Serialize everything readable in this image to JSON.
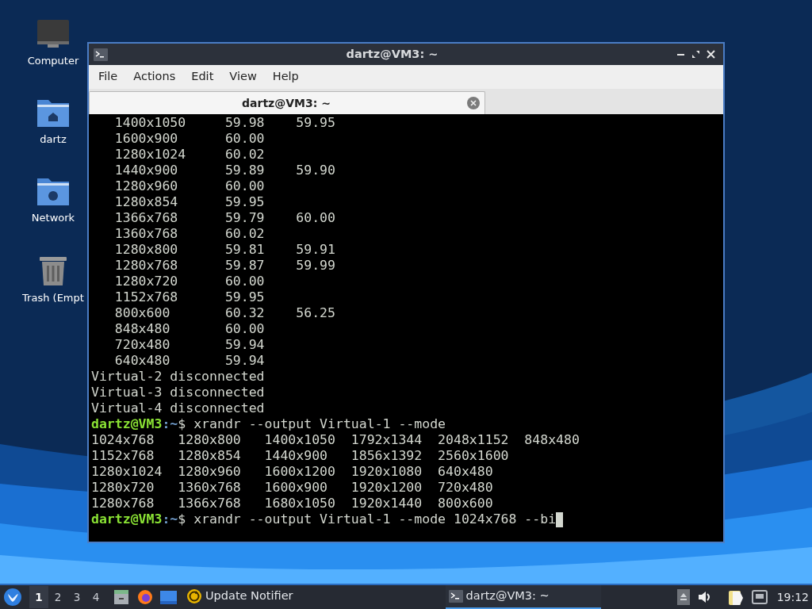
{
  "desktop_icons": [
    {
      "label": "Computer",
      "kind": "computer"
    },
    {
      "label": "dartz",
      "kind": "home"
    },
    {
      "label": "Network",
      "kind": "network"
    },
    {
      "label": "Trash (Empt",
      "kind": "trash"
    }
  ],
  "window": {
    "title": "dartz@VM3: ~",
    "menu": [
      "File",
      "Actions",
      "Edit",
      "View",
      "Help"
    ],
    "tabs": [
      {
        "label": "dartz@VM3: ~",
        "selected": true
      }
    ],
    "terminal_lines": [
      {
        "kind": "output",
        "text": "   1400x1050     59.98    59.95"
      },
      {
        "kind": "output",
        "text": "   1600x900      60.00"
      },
      {
        "kind": "output",
        "text": "   1280x1024     60.02"
      },
      {
        "kind": "output",
        "text": "   1440x900      59.89    59.90"
      },
      {
        "kind": "output",
        "text": "   1280x960      60.00"
      },
      {
        "kind": "output",
        "text": "   1280x854      59.95"
      },
      {
        "kind": "output",
        "text": "   1366x768      59.79    60.00"
      },
      {
        "kind": "output",
        "text": "   1360x768      60.02"
      },
      {
        "kind": "output",
        "text": "   1280x800      59.81    59.91"
      },
      {
        "kind": "output",
        "text": "   1280x768      59.87    59.99"
      },
      {
        "kind": "output",
        "text": "   1280x720      60.00"
      },
      {
        "kind": "output",
        "text": "   1152x768      59.95"
      },
      {
        "kind": "output",
        "text": "   800x600       60.32    56.25"
      },
      {
        "kind": "output",
        "text": "   848x480       60.00"
      },
      {
        "kind": "output",
        "text": "   720x480       59.94"
      },
      {
        "kind": "output",
        "text": "   640x480       59.94"
      },
      {
        "kind": "output",
        "text": "Virtual-2 disconnected"
      },
      {
        "kind": "output",
        "text": "Virtual-3 disconnected"
      },
      {
        "kind": "output",
        "text": "Virtual-4 disconnected"
      },
      {
        "kind": "prompt",
        "user": "dartz@VM3",
        "path": ":~",
        "command": "$ xrandr --output Virtual-1 --mode"
      },
      {
        "kind": "output",
        "text": "1024x768   1280x800   1400x1050  1792x1344  2048x1152  848x480"
      },
      {
        "kind": "output",
        "text": "1152x768   1280x854   1440x900   1856x1392  2560x1600"
      },
      {
        "kind": "output",
        "text": "1280x1024  1280x960   1600x1200  1920x1080  640x480"
      },
      {
        "kind": "output",
        "text": "1280x720   1360x768   1600x900   1920x1200  720x480"
      },
      {
        "kind": "output",
        "text": "1280x768   1366x768   1680x1050  1920x1440  800x600"
      },
      {
        "kind": "prompt",
        "user": "dartz@VM3",
        "path": ":~",
        "command": "$ xrandr --output Virtual-1 --mode 1024x768 --bi",
        "cursor": true
      }
    ]
  },
  "taskbar": {
    "workspaces": [
      {
        "label": "1",
        "selected": true
      },
      {
        "label": "2",
        "selected": false
      },
      {
        "label": "3",
        "selected": false
      },
      {
        "label": "4",
        "selected": false
      }
    ],
    "tasks": [
      {
        "label": "Update Notifier",
        "kind": "updater",
        "selected": false
      },
      {
        "label": "dartz@VM3: ~",
        "kind": "terminal",
        "selected": true
      }
    ],
    "clock": "19:12"
  }
}
